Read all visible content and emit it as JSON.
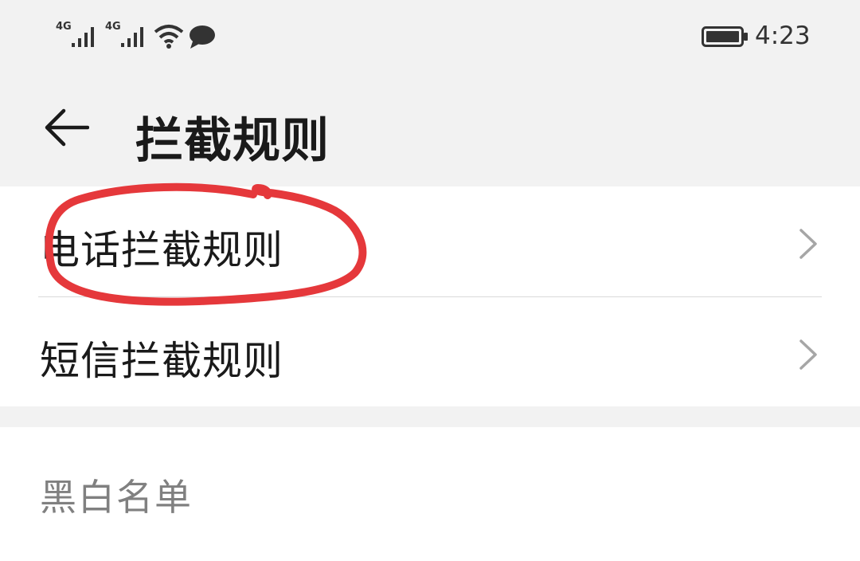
{
  "status_bar": {
    "sim1_network": "4G",
    "sim2_network": "4G",
    "time": "4:23",
    "icons": [
      "signal-icon",
      "signal-icon",
      "wifi-icon",
      "message-bubble-icon",
      "battery-icon"
    ]
  },
  "app_bar": {
    "title": "拦截规则",
    "back_icon": "arrow-left-icon"
  },
  "rules": {
    "items": [
      {
        "label": "电话拦截规则",
        "icon": "chevron-right-icon"
      },
      {
        "label": "短信拦截规则",
        "icon": "chevron-right-icon"
      }
    ]
  },
  "section": {
    "title": "黑白名单"
  },
  "colors": {
    "background": "#f2f2f2",
    "card": "#ffffff",
    "annotation": "#e5383b"
  }
}
